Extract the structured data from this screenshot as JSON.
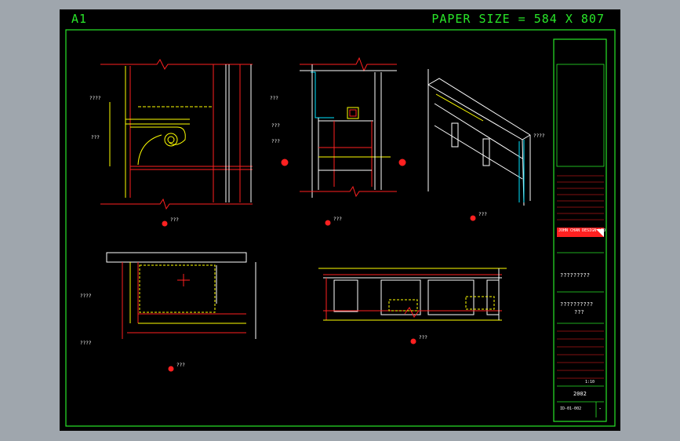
{
  "sheet": {
    "size_label": "A1",
    "paper_size_label": "PAPER SIZE = 584 X 807"
  },
  "title_block": {
    "project_name": "?????????",
    "drawing_title": "??????????",
    "drawing_title_sub": "???",
    "scale_value": "1:10",
    "year": "2002",
    "drawing_no": "ID-01-002",
    "sheet_suffix": "-",
    "company_banner": "JOHN CHAN DESIGN LTD"
  },
  "callouts": {
    "section_a": "???",
    "section_b": "???",
    "section_c": "???",
    "section_d": "???",
    "section_e": "???"
  },
  "notes": {
    "a1": "????",
    "a2": "???",
    "b1": "???",
    "b2": "???",
    "b3": "???",
    "c1": "????",
    "d1": "????",
    "d2": "????"
  },
  "colors": {
    "cad_background": "#000000",
    "app_background": "#9fa6ad",
    "border": "#29e629",
    "dimension": "#ffff00",
    "outline": "#ff2020",
    "text": "#ffffff"
  }
}
